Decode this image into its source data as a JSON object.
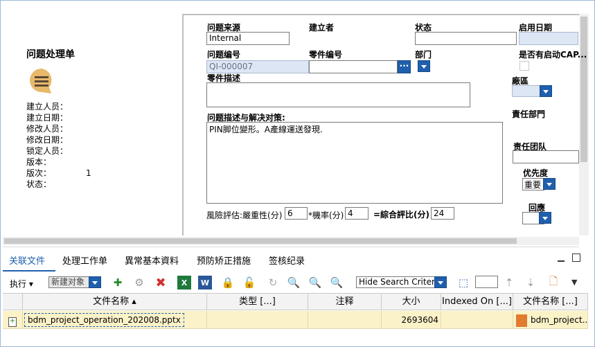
{
  "left_panel": {
    "title": "问题处理单",
    "icon": "chat-bubble-icon",
    "meta": [
      {
        "label": "建立人员：",
        "value": ""
      },
      {
        "label": "建立日期：",
        "value": ""
      },
      {
        "label": "修改人员：",
        "value": ""
      },
      {
        "label": "修改日期：",
        "value": ""
      },
      {
        "label": "锁定人员：",
        "value": ""
      },
      {
        "label": "版本：",
        "value": ""
      },
      {
        "label": "版次：",
        "value": "1"
      },
      {
        "label": "状态：",
        "value": ""
      }
    ]
  },
  "form": {
    "source_label": "问题来源",
    "source_value": "Internal",
    "creator_label": "建立者",
    "status_label": "状态",
    "enable_date_label": "启用日期",
    "issue_no_label": "问题编号",
    "issue_no_value": "QI-000007",
    "part_no_label": "零件编号",
    "dept_label": "部门",
    "capa_label": "是否有启动CAP...",
    "part_desc_label": "零件描述",
    "factory_label": "廠區",
    "resp_dept_label": "責任部門",
    "problem_label": "问题描述与解决对策:",
    "problem_value": "PIN脚位變形。A產線運送發現.",
    "resp_team_label": "责任团队",
    "priority_label": "优先度",
    "priority_value": "重要",
    "reply_label": "回應",
    "risk_label": "風險評估:嚴重性(分)",
    "severity_value": "6",
    "prob_label": "*機率(分)",
    "prob_value": "4",
    "score_label": "=綜合評比(分)",
    "score_value": "24"
  },
  "tabs": [
    "关联文件",
    "处理工作单",
    "異常基本資料",
    "预防矫正措施",
    "签核纪录"
  ],
  "toolbar": {
    "execute_label": "执行",
    "new_object_label": "新建对象",
    "search_criteria_label": "Hide Search Criteria"
  },
  "table": {
    "headers": [
      "文件名称",
      "类型 [...]",
      "注释",
      "大小",
      "Indexed On [...]",
      "文件名称 [...]"
    ],
    "rows": [
      {
        "filename": "bdm_project_operation_202008.pptx",
        "type": "",
        "comment": "",
        "size": "2693604",
        "indexed_on": "",
        "filename2": "bdm_project..."
      }
    ]
  },
  "colors": {
    "accent": "#1f5fad",
    "tab_active": "#1f5fad",
    "row_highlight": "#fbf2c8",
    "icon_orange": "#e8b96b"
  }
}
